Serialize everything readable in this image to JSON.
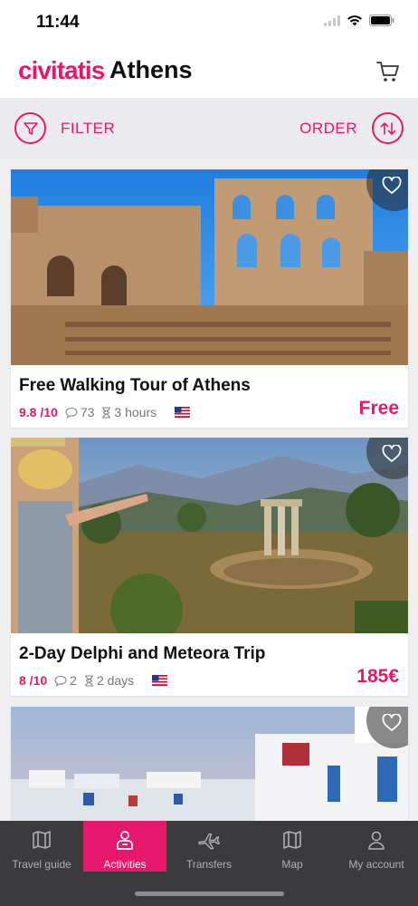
{
  "status_bar": {
    "time": "11:44"
  },
  "header": {
    "brand": "civitatis",
    "city": "Athens"
  },
  "toolbar": {
    "filter_label": "FILTER",
    "order_label": "ORDER"
  },
  "activities": [
    {
      "title": "Free Walking Tour of Athens",
      "rating": "9.8 /10",
      "reviews": "73",
      "duration": "3 hours",
      "language": "English (US flag)",
      "price": "Free"
    },
    {
      "title": "2-Day Delphi and Meteora Trip",
      "rating": "8 /10",
      "reviews": "2",
      "duration": "2 days",
      "language": "English (US flag)",
      "price": "185€"
    },
    {
      "title": "",
      "rating": "",
      "reviews": "",
      "duration": "",
      "price": ""
    }
  ],
  "tabs": [
    {
      "label": "Travel guide",
      "icon": "map-book-icon",
      "active": false
    },
    {
      "label": "Activities",
      "icon": "person-icon",
      "active": true
    },
    {
      "label": "Transfers",
      "icon": "plane-icon",
      "active": false
    },
    {
      "label": "Map",
      "icon": "map-icon",
      "active": false
    },
    {
      "label": "My account",
      "icon": "user-icon",
      "active": false
    }
  ],
  "colors": {
    "brand": "#e6186c",
    "tab_bar": "#3b3b3d",
    "background": "#efeff1"
  }
}
